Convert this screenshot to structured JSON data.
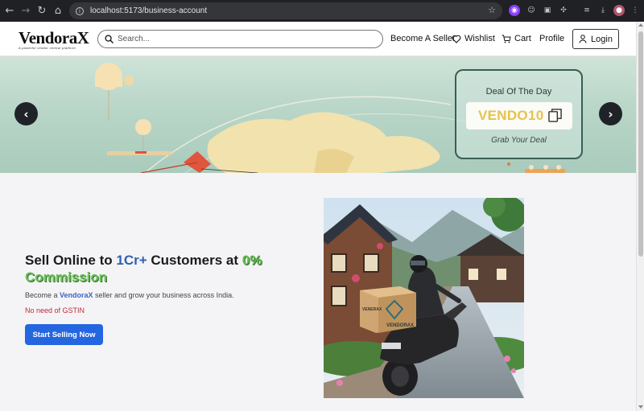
{
  "browser": {
    "url": "localhost:5173/business-account"
  },
  "header": {
    "logo_name": "VendoraX",
    "logo_tagline": "A powerful vendor central platform",
    "search_placeholder": "Search...",
    "become_seller": "Become A Seller",
    "wishlist": "Wishlist",
    "cart": "Cart",
    "profile": "Profile",
    "login": "Login"
  },
  "banner": {
    "deal_title": "Deal Of The Day",
    "coupon_code": "VENDO10",
    "deal_subtitle": "Grab Your Deal"
  },
  "hero": {
    "title_part1": "Sell Online to ",
    "title_highlight1": "1Cr+",
    "title_part2": " Customers at ",
    "title_highlight2": "0% Commission",
    "desc_prefix": "Become a ",
    "desc_brand": "VendoraX",
    "desc_suffix": " seller and grow your business across India.",
    "gst_note": "No need of GSTIN",
    "cta": "Start Selling Now",
    "box_label_front": "VENDORAX",
    "box_label_side": "VENERAX"
  },
  "colors": {
    "accent_blue": "#2466e0",
    "highlight_blue": "#2f5fb4",
    "highlight_green": "#6bbf5a",
    "coupon_yellow": "#e6c34c",
    "gst_red": "#c0293a"
  }
}
